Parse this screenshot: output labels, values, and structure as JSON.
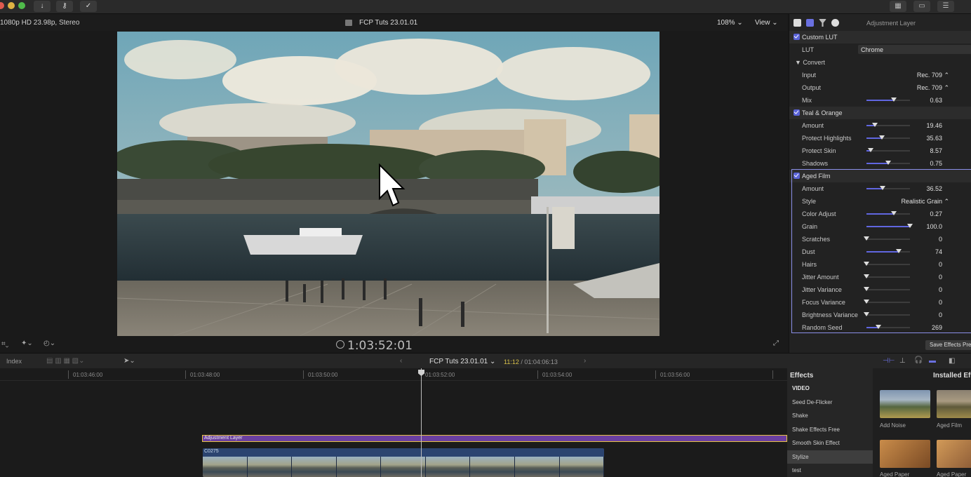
{
  "viewer": {
    "format": "1080p HD 23.98p, Stereo",
    "title": "FCP Tuts 23.01.01",
    "zoom": "108%",
    "view": "View",
    "timecode": "1:03:52:01"
  },
  "inspector": {
    "title": "Adjustment Layer",
    "rows": [
      {
        "type": "section",
        "label": "Custom LUT",
        "checked": true
      },
      {
        "type": "popup",
        "label": "LUT",
        "value": "Chrome"
      },
      {
        "type": "group",
        "label": "▼ Convert"
      },
      {
        "type": "value",
        "label": "Input",
        "value": "Rec. 709 ⌃"
      },
      {
        "type": "value",
        "label": "Output",
        "value": "Rec. 709 ⌃"
      },
      {
        "type": "slider",
        "label": "Mix",
        "value": "0.63",
        "level": 0.63
      },
      {
        "type": "section",
        "label": "Teal & Orange",
        "checked": true
      },
      {
        "type": "slider",
        "label": "Amount",
        "value": "19.46",
        "level": 0.19
      },
      {
        "type": "slider",
        "label": "Protect Highlights",
        "value": "35.63",
        "level": 0.36
      },
      {
        "type": "slider",
        "label": "Protect Skin",
        "value": "8.57",
        "level": 0.09
      },
      {
        "type": "slider",
        "label": "Shadows",
        "value": "0.75",
        "level": 0.5
      },
      {
        "type": "section",
        "label": "Aged Film",
        "checked": true
      },
      {
        "type": "slider",
        "label": "Amount",
        "value": "36.52",
        "level": 0.37
      },
      {
        "type": "value",
        "label": "Style",
        "value": "Realistic Grain ⌃"
      },
      {
        "type": "slider",
        "label": "Color Adjust",
        "value": "0.27",
        "level": 0.63
      },
      {
        "type": "slider",
        "label": "Grain",
        "value": "100.0",
        "level": 1.0
      },
      {
        "type": "slider",
        "label": "Scratches",
        "value": "0",
        "level": 0.0
      },
      {
        "type": "slider",
        "label": "Dust",
        "value": "74",
        "level": 0.74
      },
      {
        "type": "slider",
        "label": "Hairs",
        "value": "0",
        "level": 0.0
      },
      {
        "type": "slider",
        "label": "Jitter Amount",
        "value": "0",
        "level": 0.0
      },
      {
        "type": "slider",
        "label": "Jitter Variance",
        "value": "0",
        "level": 0.0
      },
      {
        "type": "slider",
        "label": "Focus Variance",
        "value": "0",
        "level": 0.0
      },
      {
        "type": "slider",
        "label": "Brightness Variance",
        "value": "0",
        "level": 0.0
      },
      {
        "type": "slider",
        "label": "Random Seed",
        "value": "269",
        "level": 0.27
      }
    ],
    "save_button": "Save Effects Preset"
  },
  "timeline_toolbar": {
    "index": "Index",
    "title": "FCP Tuts 23.01.01",
    "current": "11:12",
    "total": " / 01:04:06:13"
  },
  "timeline": {
    "ruler": [
      "01:03:46:00",
      "01:03:48:00",
      "01:03:50:00",
      "01:03:52:00",
      "01:03:54:00",
      "01:03:56:00"
    ],
    "adjustment_clip": "Adjustment Layer",
    "video_clip": "C0275"
  },
  "effects": {
    "header": "Effects",
    "installed_header": "Installed Effects",
    "items": [
      "VIDEO",
      "Seed De-Flicker",
      "Shake",
      "Shake Effects Free",
      "Smooth Skin Effect",
      "Stylize",
      "test"
    ],
    "selected": "Stylize",
    "thumbs": [
      "Add Noise",
      "Aged Film",
      "Aged Paper",
      "Aged Paper"
    ]
  },
  "colors": {
    "accent": "#5a63d8",
    "timecode_current": "#d8c14a",
    "adjustment_clip": "#6b3fa0",
    "clip_border": "#e6c243"
  }
}
